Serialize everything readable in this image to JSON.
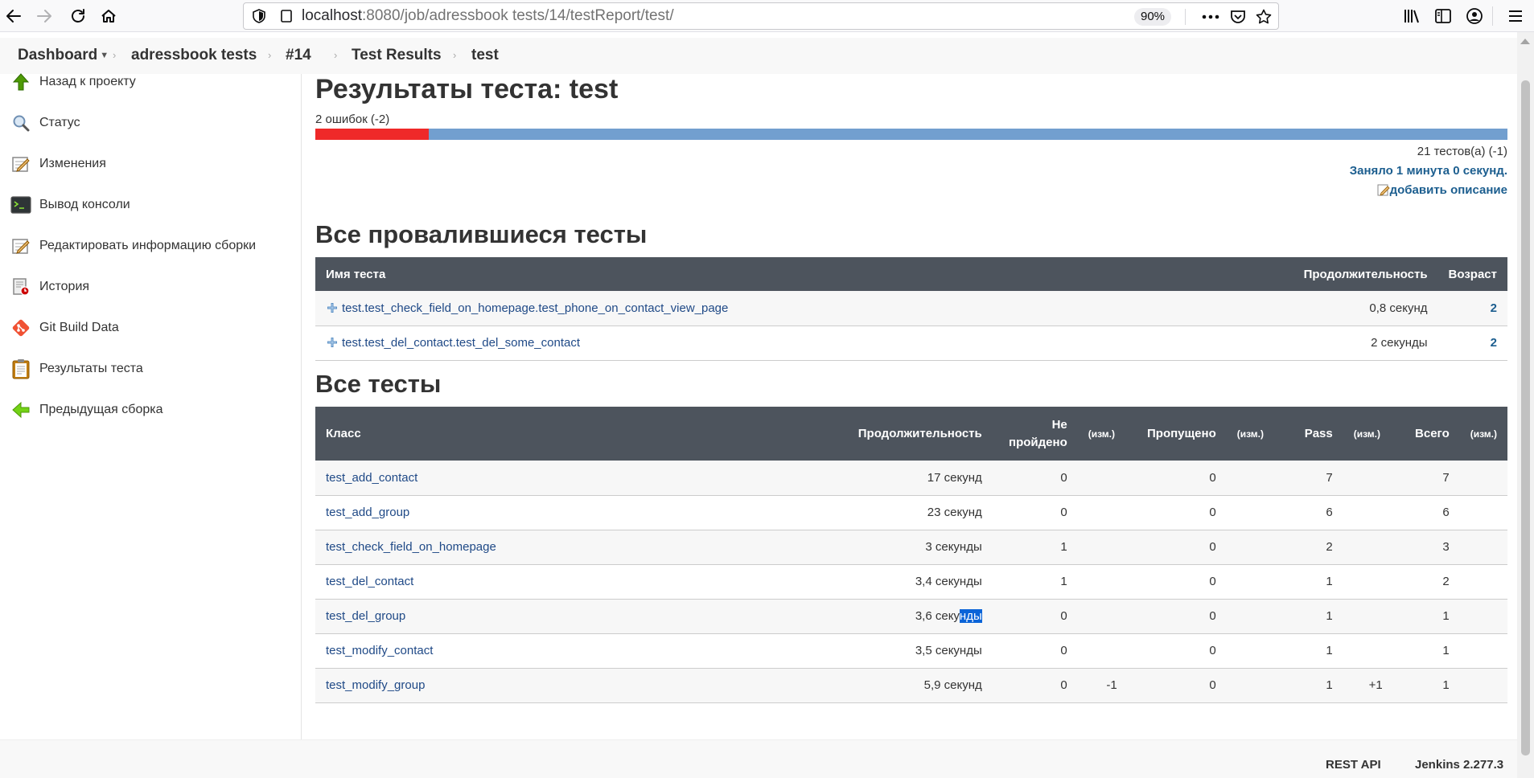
{
  "browser": {
    "url_host": "localhost",
    "url_rest": ":8080/job/adressbook tests/14/testReport/test/",
    "zoom": "90%"
  },
  "breadcrumbs": {
    "dashboard": "Dashboard",
    "job": "adressbook tests",
    "build": "#14",
    "test_results": "Test Results",
    "current": "test"
  },
  "sidebar": {
    "items": [
      {
        "label": "Назад к проекту",
        "icon": "arrow-up-icon"
      },
      {
        "label": "Статус",
        "icon": "magnifier-icon"
      },
      {
        "label": "Изменения",
        "icon": "notepad-icon"
      },
      {
        "label": "Вывод консоли",
        "icon": "terminal-icon"
      },
      {
        "label": "Редактировать информацию сборки",
        "icon": "notepad-icon"
      },
      {
        "label": "История",
        "icon": "history-icon"
      },
      {
        "label": "Git Build Data",
        "icon": "git-icon"
      },
      {
        "label": "Результаты теста",
        "icon": "clipboard-icon"
      },
      {
        "label": "Предыдущая сборка",
        "icon": "arrow-left-icon"
      }
    ]
  },
  "report": {
    "title": "Результаты теста: test",
    "fail_summary": "2 ошибок (-2)",
    "fail_fraction": 0.095,
    "tests_count": "21 тестов(а) (-1)",
    "duration": "Заняло 1 минута 0 секунд.",
    "add_description": "добавить описание"
  },
  "failed": {
    "heading": "Все провалившиеся тесты",
    "columns": {
      "name": "Имя теста",
      "duration": "Продолжительность",
      "age": "Возраст"
    },
    "rows": [
      {
        "name": "test.test_check_field_on_homepage.test_phone_on_contact_view_page",
        "duration": "0,8 секунд",
        "age": "2"
      },
      {
        "name": "test.test_del_contact.test_del_some_contact",
        "duration": "2 секунды",
        "age": "2"
      }
    ]
  },
  "all": {
    "heading": "Все тесты",
    "columns": {
      "class": "Класс",
      "duration": "Продолжительность",
      "failed_1": "Не",
      "failed_2": "пройдено",
      "diff": "(изм.)",
      "skipped": "Пропущено",
      "pass": "Pass",
      "total": "Всего"
    },
    "rows": [
      {
        "name": "test_add_contact",
        "duration": "17 секунд",
        "failed": "0",
        "failed_diff": "",
        "skipped": "0",
        "skipped_diff": "",
        "pass": "7",
        "pass_diff": "",
        "total": "7",
        "total_diff": ""
      },
      {
        "name": "test_add_group",
        "duration": "23 секунд",
        "failed": "0",
        "failed_diff": "",
        "skipped": "0",
        "skipped_diff": "",
        "pass": "6",
        "pass_diff": "",
        "total": "6",
        "total_diff": ""
      },
      {
        "name": "test_check_field_on_homepage",
        "duration": "3 секунды",
        "failed": "1",
        "failed_diff": "",
        "skipped": "0",
        "skipped_diff": "",
        "pass": "2",
        "pass_diff": "",
        "total": "3",
        "total_diff": ""
      },
      {
        "name": "test_del_contact",
        "duration": "3,4 секунды",
        "failed": "1",
        "failed_diff": "",
        "skipped": "0",
        "skipped_diff": "",
        "pass": "1",
        "pass_diff": "",
        "total": "2",
        "total_diff": ""
      },
      {
        "name": "test_del_group",
        "duration_a": "3,6 секу",
        "duration_b": "нды",
        "failed": "0",
        "failed_diff": "",
        "skipped": "0",
        "skipped_diff": "",
        "pass": "1",
        "pass_diff": "",
        "total": "1",
        "total_diff": ""
      },
      {
        "name": "test_modify_contact",
        "duration": "3,5 секунды",
        "failed": "0",
        "failed_diff": "",
        "skipped": "0",
        "skipped_diff": "",
        "pass": "1",
        "pass_diff": "",
        "total": "1",
        "total_diff": ""
      },
      {
        "name": "test_modify_group",
        "duration": "5,9 секунд",
        "failed": "0",
        "failed_diff": "-1",
        "skipped": "0",
        "skipped_diff": "",
        "pass": "1",
        "pass_diff": "+1",
        "total": "1",
        "total_diff": ""
      }
    ]
  },
  "footer": {
    "rest_api": "REST API",
    "version": "Jenkins 2.277.3"
  },
  "colors": {
    "fail": "#ef2929",
    "pass": "#729fcf",
    "header_bg": "#4d545d",
    "link": "#204a87"
  }
}
